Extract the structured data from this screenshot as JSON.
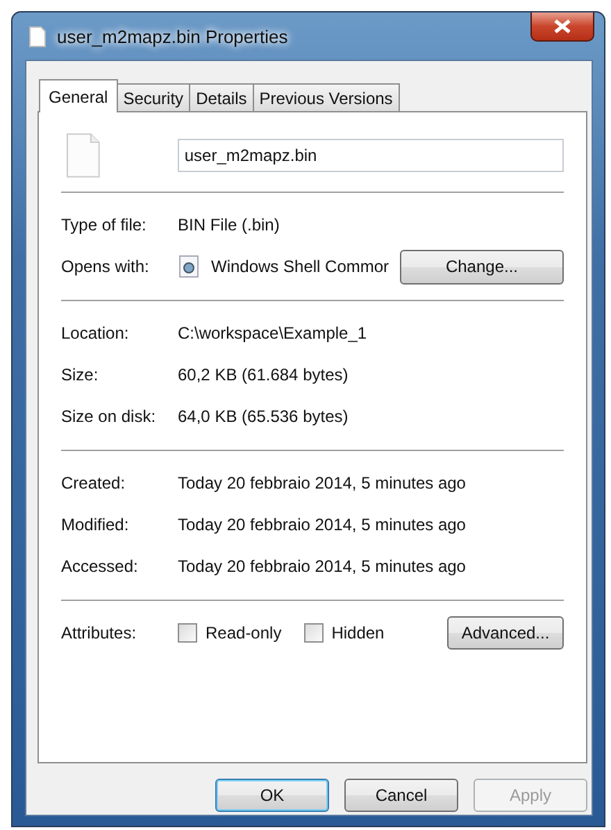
{
  "window": {
    "title": "user_m2mapz.bin Properties"
  },
  "tabs": [
    {
      "label": "General",
      "selected": true
    },
    {
      "label": "Security",
      "selected": false
    },
    {
      "label": "Details",
      "selected": false
    },
    {
      "label": "Previous Versions",
      "selected": false
    }
  ],
  "file_name": {
    "value": "user_m2mapz.bin"
  },
  "type_section": [
    {
      "label": "Type of file:",
      "value": "BIN File (.bin)"
    },
    {
      "label": "Opens with:",
      "value": "Windows Shell Commor",
      "button": "Change..."
    }
  ],
  "location_section": [
    {
      "label": "Location:",
      "value": "C:\\workspace\\Example_1"
    },
    {
      "label": "Size:",
      "value": "60,2 KB (61.684 bytes)"
    },
    {
      "label": "Size on disk:",
      "value": "64,0 KB (65.536 bytes)"
    }
  ],
  "date_section": [
    {
      "label": "Created:",
      "value": "Today 20 febbraio 2014, 5 minutes ago"
    },
    {
      "label": "Modified:",
      "value": "Today 20 febbraio 2014, 5 minutes ago"
    },
    {
      "label": "Accessed:",
      "value": "Today 20 febbraio 2014, 5 minutes ago"
    }
  ],
  "attributes": {
    "label": "Attributes:",
    "options": [
      {
        "label": "Read-only",
        "checked": false
      },
      {
        "label": "Hidden",
        "checked": false
      }
    ],
    "button": "Advanced..."
  },
  "buttons": [
    {
      "label": "OK",
      "kind": "default",
      "disabled": false
    },
    {
      "label": "Cancel",
      "kind": "normal",
      "disabled": false
    },
    {
      "label": "Apply",
      "kind": "normal",
      "disabled": true
    }
  ]
}
